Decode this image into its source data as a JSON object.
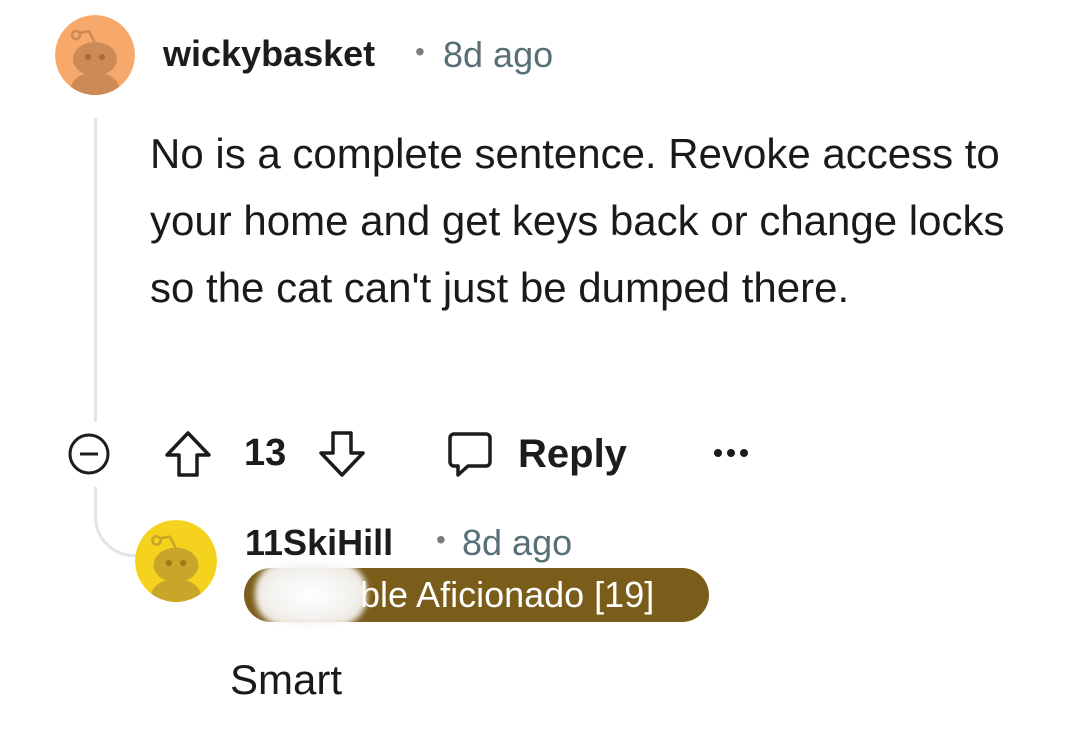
{
  "thread": {
    "comment": {
      "author": "wickybasket",
      "separator": "•",
      "time": "8d ago",
      "body": "No is a complete sentence. Revoke access to your home and get keys back or change locks so the cat can't just be dumped there.",
      "avatar_icon": "snoo-avatar-icon",
      "avatar_color": "#f6a96b",
      "actions": {
        "collapse_icon": "collapse-minus-icon",
        "upvote_icon": "upvote-arrow-icon",
        "vote_count": "13",
        "downvote_icon": "downvote-arrow-icon",
        "reply_icon": "speech-bubble-icon",
        "reply_label": "Reply",
        "more_icon": "more-dots-icon"
      }
    },
    "reply": {
      "author": "11SkiHill",
      "separator": "•",
      "time": "8d ago",
      "flair": "ble Aficionado [19]",
      "flair_color": "#7b5d1b",
      "body": "Smart",
      "avatar_icon": "snoo-avatar-icon",
      "avatar_color": "#f5d21e"
    }
  }
}
